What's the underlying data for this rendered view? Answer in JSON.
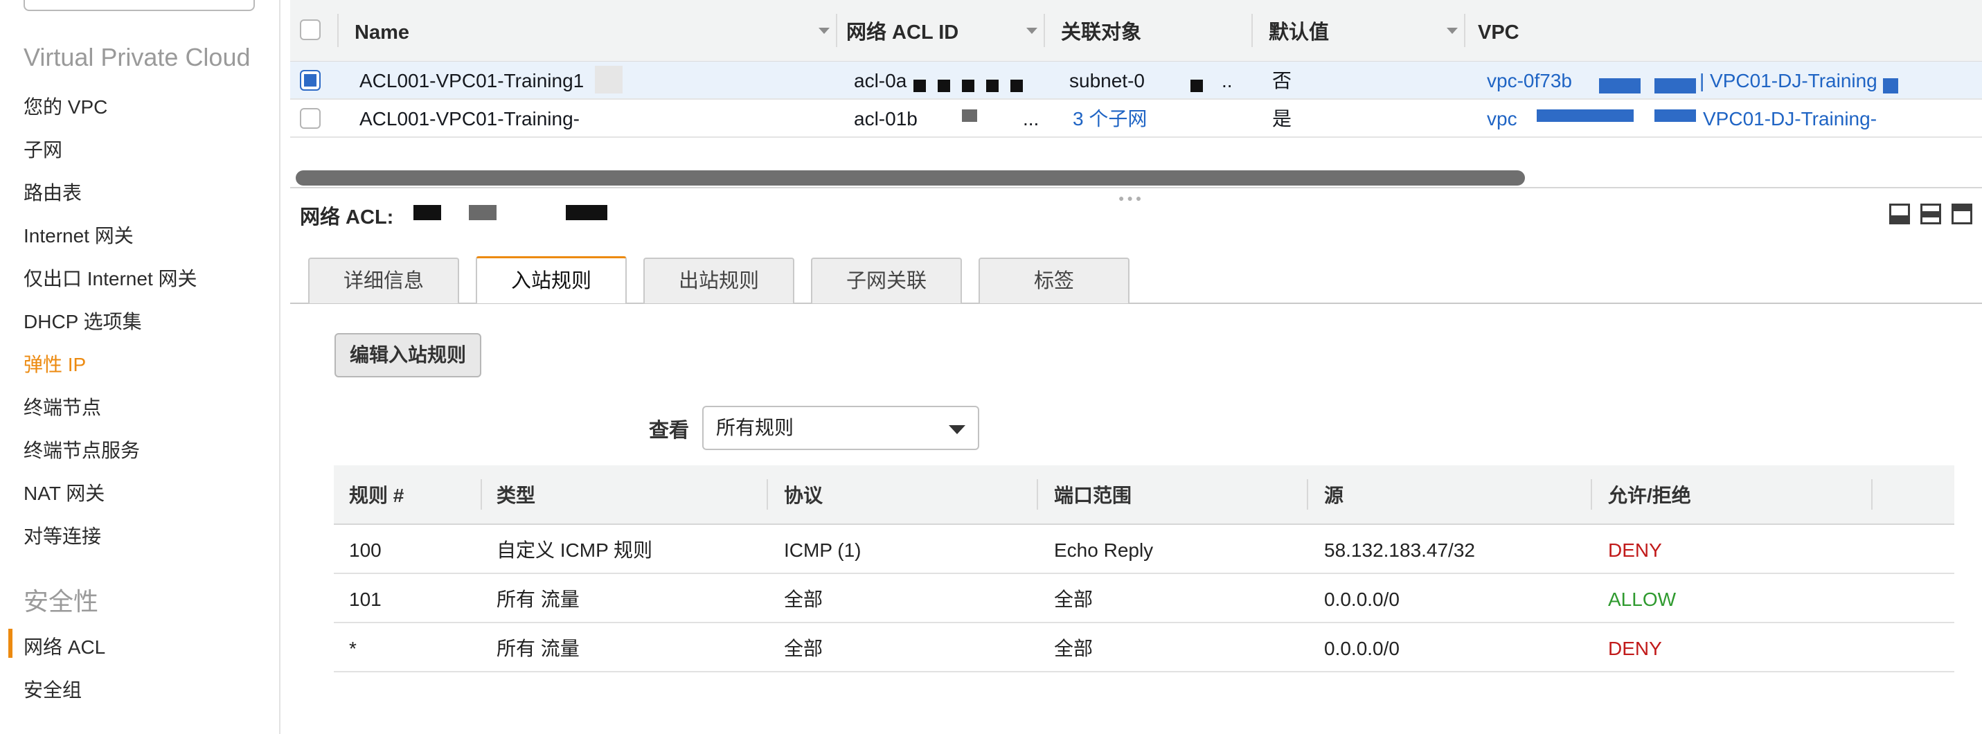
{
  "sidebar": {
    "section_vpc": "Virtual Private Cloud",
    "items": [
      {
        "label": "您的 VPC"
      },
      {
        "label": "子网"
      },
      {
        "label": "路由表"
      },
      {
        "label": "Internet 网关"
      },
      {
        "label": "仅出口 Internet 网关"
      },
      {
        "label": "DHCP 选项集"
      },
      {
        "label": "弹性 IP"
      },
      {
        "label": "终端节点"
      },
      {
        "label": "终端节点服务"
      },
      {
        "label": "NAT 网关"
      },
      {
        "label": "对等连接"
      }
    ],
    "section_security": "安全性",
    "security_items": [
      {
        "label": "网络 ACL",
        "active": true
      },
      {
        "label": "安全组"
      }
    ]
  },
  "grid": {
    "columns": [
      "Name",
      "网络 ACL ID",
      "关联对象",
      "默认值",
      "VPC"
    ],
    "rows": [
      {
        "name": "ACL001-VPC01-Training1",
        "acl_id": "acl-0a",
        "assoc": "subnet-0",
        "assoc_more": "..",
        "default": "否",
        "vpc": "vpc-0f73b",
        "vpc_name": "| VPC01-DJ-Training",
        "selected": true
      },
      {
        "name": "ACL001-VPC01-Training-",
        "acl_id": "acl-01b",
        "assoc": "3 个子网",
        "assoc_more": "...",
        "default": "是",
        "vpc": "vpc",
        "vpc_name": "VPC01-DJ-Training-",
        "selected": false
      }
    ]
  },
  "detail": {
    "title": "网络 ACL:",
    "tabs": [
      "详细信息",
      "入站规则",
      "出站规则",
      "子网关联",
      "标签"
    ],
    "active_tab": "入站规则",
    "edit_button": "编辑入站规则",
    "filter_label": "查看",
    "filter_value": "所有规则",
    "rules_columns": [
      "规则 #",
      "类型",
      "协议",
      "端口范围",
      "源",
      "允许/拒绝"
    ],
    "rules": [
      {
        "rule": "100",
        "type": "自定义 ICMP 规则",
        "protocol": "ICMP (1)",
        "port": "Echo Reply",
        "source": "58.132.183.47/32",
        "action": "DENY"
      },
      {
        "rule": "101",
        "type": "所有 流量",
        "protocol": "全部",
        "port": "全部",
        "source": "0.0.0.0/0",
        "action": "ALLOW"
      },
      {
        "rule": "*",
        "type": "所有 流量",
        "protocol": "全部",
        "port": "全部",
        "source": "0.0.0.0/0",
        "action": "DENY"
      }
    ]
  },
  "colors": {
    "accent": "#ec8a10",
    "link": "#1f64c4",
    "deny": "#c11a1a",
    "allow": "#2f9a2f",
    "selected_row": "#eaf2fb"
  },
  "icons": {
    "layout": [
      "layout-bottom-pane-icon",
      "layout-split-pane-icon",
      "layout-top-pane-icon"
    ]
  }
}
